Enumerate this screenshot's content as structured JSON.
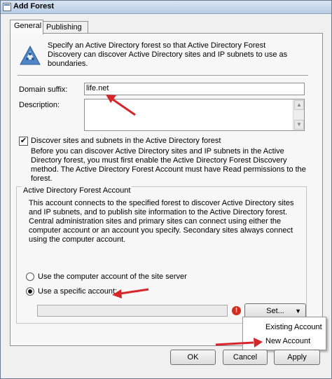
{
  "window": {
    "title": "Add Forest"
  },
  "tabs": [
    {
      "label": "General"
    },
    {
      "label": "Publishing"
    }
  ],
  "intro": {
    "text": "Specify an Active Directory forest so that Active Directory Forest Discovery can discover Active Directory sites and IP subnets to use as boundaries."
  },
  "domain_suffix": {
    "label": "Domain suffix:",
    "value": "life.net"
  },
  "description": {
    "label": "Description:",
    "value": ""
  },
  "discover": {
    "checked": true,
    "label": "Discover sites and subnets in the Active Directory forest",
    "desc": "Before you can discover Active Directory sites and IP subnets in the Active Directory forest, you must first enable the Active Directory Forest Discovery method. The Active Directory Forest Account must have Read permissions to the forest."
  },
  "account_group": {
    "legend": "Active Directory Forest Account",
    "desc": "This account connects to the specified forest to discover Active Directory sites and IP subnets, and to publish site information to the Active Directory forest. Central administration sites and primary sites can connect using either the computer account or an account you specify. Secondary sites always connect using the computer account.",
    "radio_computer": "Use the computer account of the site server",
    "radio_specific": "Use a specific account:",
    "selected": "specific",
    "account_value": "",
    "set_label": "Set...",
    "set_arrow": "▼",
    "error_glyph": "!"
  },
  "set_menu": {
    "items": [
      "Existing Account",
      "New Account"
    ]
  },
  "buttons": {
    "ok": "OK",
    "cancel": "Cancel",
    "apply": "Apply"
  },
  "colors": {
    "annotation_arrow": "#d7262a",
    "error_icon": "#d32b1e"
  },
  "icons": {
    "title": "window-icon",
    "header": "forest-triangle-icon"
  }
}
